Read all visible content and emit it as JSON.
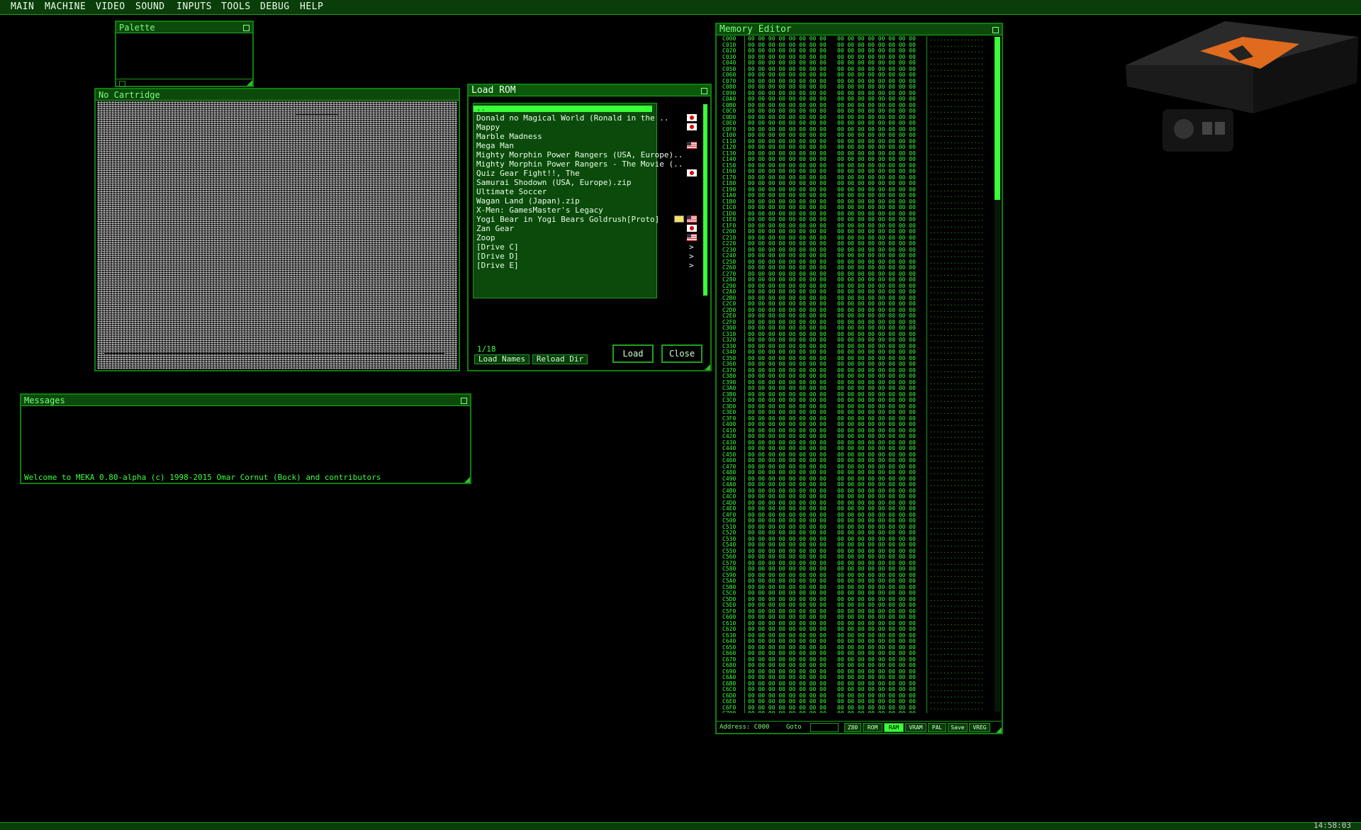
{
  "menu": {
    "items": [
      "MAIN",
      "MACHINE",
      "VIDEO",
      "SOUND",
      "INPUTS",
      "TOOLS",
      "DEBUG",
      "HELP"
    ]
  },
  "palette": {
    "title": "Palette"
  },
  "game": {
    "title": "No Cartridge"
  },
  "messages": {
    "title": "Messages",
    "welcome": "Welcome to MEKA 0.80-alpha (c) 1998-2015 Omar Cornut (Bock) and contributors"
  },
  "loadrom": {
    "title": "Load ROM",
    "selected": "..",
    "entries": [
      {
        "name": "Donald no Magical World (Ronald in the ..",
        "flag": "jp"
      },
      {
        "name": "Mappy",
        "flag": "jp"
      },
      {
        "name": "Marble Madness",
        "flag": ""
      },
      {
        "name": "Mega Man",
        "flag": "us"
      },
      {
        "name": "Mighty Morphin Power Rangers (USA, Europe)..",
        "flag": ""
      },
      {
        "name": "Mighty Morphin Power Rangers - The Movie (..",
        "flag": ""
      },
      {
        "name": "Quiz Gear Fight!!, The",
        "flag": "jp"
      },
      {
        "name": "Samurai Shodown (USA, Europe).zip",
        "flag": ""
      },
      {
        "name": "Ultimate Soccer",
        "flag": ""
      },
      {
        "name": "Wagan Land (Japan).zip",
        "flag": ""
      },
      {
        "name": "X-Men: GamesMaster's Legacy",
        "flag": ""
      },
      {
        "name": "Yogi Bear in Yogi Bears Goldrush[Proto]",
        "flag": "us",
        "flag2": "br"
      },
      {
        "name": "Zan Gear",
        "flag": "jp"
      },
      {
        "name": "Zoop",
        "flag": "us"
      },
      {
        "name": "[Drive C]",
        "arrow": ">"
      },
      {
        "name": "[Drive D]",
        "arrow": ">"
      },
      {
        "name": "[Drive E]",
        "arrow": ">"
      }
    ],
    "counter": "1/18",
    "load_names": "Load Names",
    "reload_dir": "Reload Dir",
    "load": "Load",
    "close": "Close"
  },
  "memeditor": {
    "title": "Memory Editor",
    "address_label": "Address: C000",
    "goto_label": "Goto",
    "buttons": [
      "Z80",
      "ROM",
      "RAM",
      "VRAM",
      "PAL",
      "Save",
      "VREG"
    ],
    "active_button": "RAM",
    "start_address": "C000",
    "end_address": "C780",
    "fill_byte": "00",
    "ascii_fill": "."
  },
  "colors": {
    "accent": "#39ff39",
    "window_border": "#0e7f0e",
    "title_bg": "#0b4a0b"
  },
  "status": {
    "clock": "14:58:03"
  }
}
